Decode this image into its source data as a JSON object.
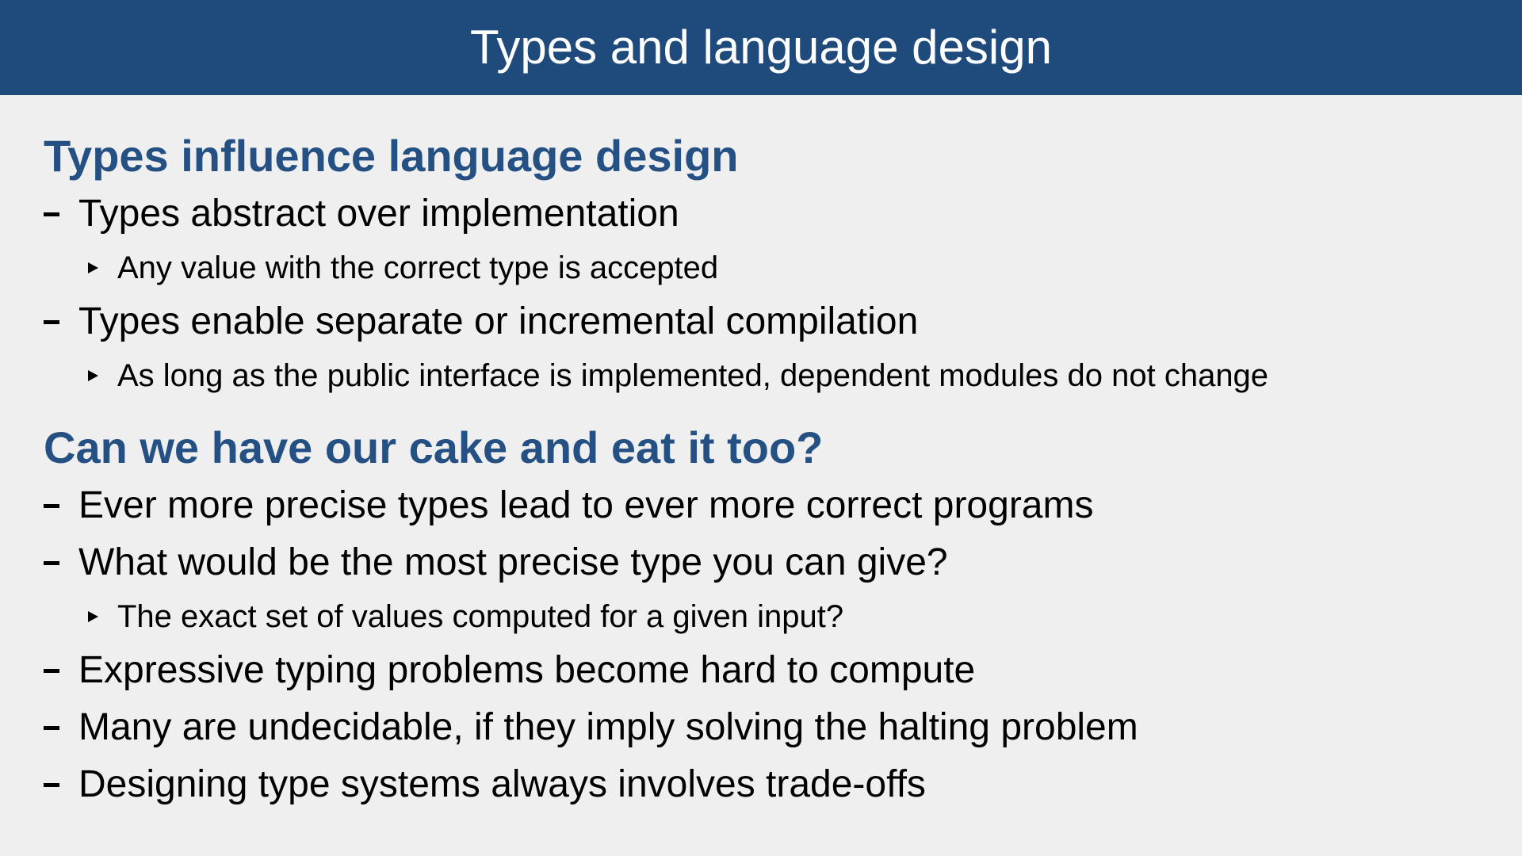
{
  "slide": {
    "title": "Types and language design",
    "colors": {
      "title_bar": "#1f4a7c",
      "title_text": "#ffffff",
      "heading": "#245083",
      "background": "#efefef",
      "body_text": "#000000"
    }
  },
  "sections": [
    {
      "heading": "Types influence language design",
      "items": [
        {
          "text": "Types abstract over implementation",
          "subitems": [
            "Any value with the correct type is accepted"
          ]
        },
        {
          "text": "Types enable separate or incremental compilation",
          "subitems": [
            "As long as the public interface is implemented, dependent modules do not change"
          ]
        }
      ]
    },
    {
      "heading": "Can we have our cake and eat it too?",
      "items": [
        {
          "text": "Ever more precise types lead to ever more correct programs",
          "subitems": []
        },
        {
          "text": "What would be the most precise type you can give?",
          "subitems": [
            "The exact set of values computed for a given input?"
          ]
        },
        {
          "text": "Expressive typing problems become hard to compute",
          "subitems": []
        },
        {
          "text": "Many are undecidable, if they imply solving the halting problem",
          "subitems": []
        },
        {
          "text": "Designing type systems always involves trade-offs",
          "subitems": []
        }
      ]
    }
  ],
  "icons": {
    "item_bullet": "dash-icon",
    "subitem_bullet": "triangle-icon"
  }
}
